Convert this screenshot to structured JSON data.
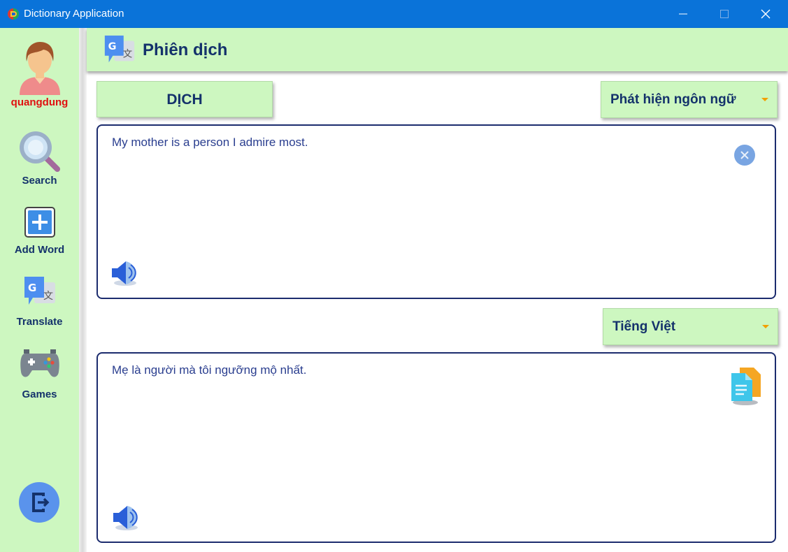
{
  "window": {
    "title": "Dictionary Application"
  },
  "sidebar": {
    "username": "quangdung",
    "items": [
      {
        "label": "Search",
        "icon": "magnifier-icon"
      },
      {
        "label": "Add Word",
        "icon": "plus-icon"
      },
      {
        "label": "Translate",
        "icon": "translate-icon"
      },
      {
        "label": "Games",
        "icon": "gamepad-icon"
      }
    ],
    "logout_icon": "logout-icon"
  },
  "header": {
    "title": "Phiên dịch",
    "icon": "translate-icon"
  },
  "translate": {
    "button_label": "DỊCH",
    "source_lang": "Phát hiện ngôn ngữ",
    "source_text": "My mother is a person I admire most.",
    "target_lang": "Tiếng Việt",
    "target_text": "Mẹ là người mà tôi ngưỡng mộ nhất."
  },
  "colors": {
    "titlebar": "#0a73d9",
    "accent_green": "#cdf7c0",
    "text_navy": "#14326b",
    "username_red": "#e01010"
  }
}
